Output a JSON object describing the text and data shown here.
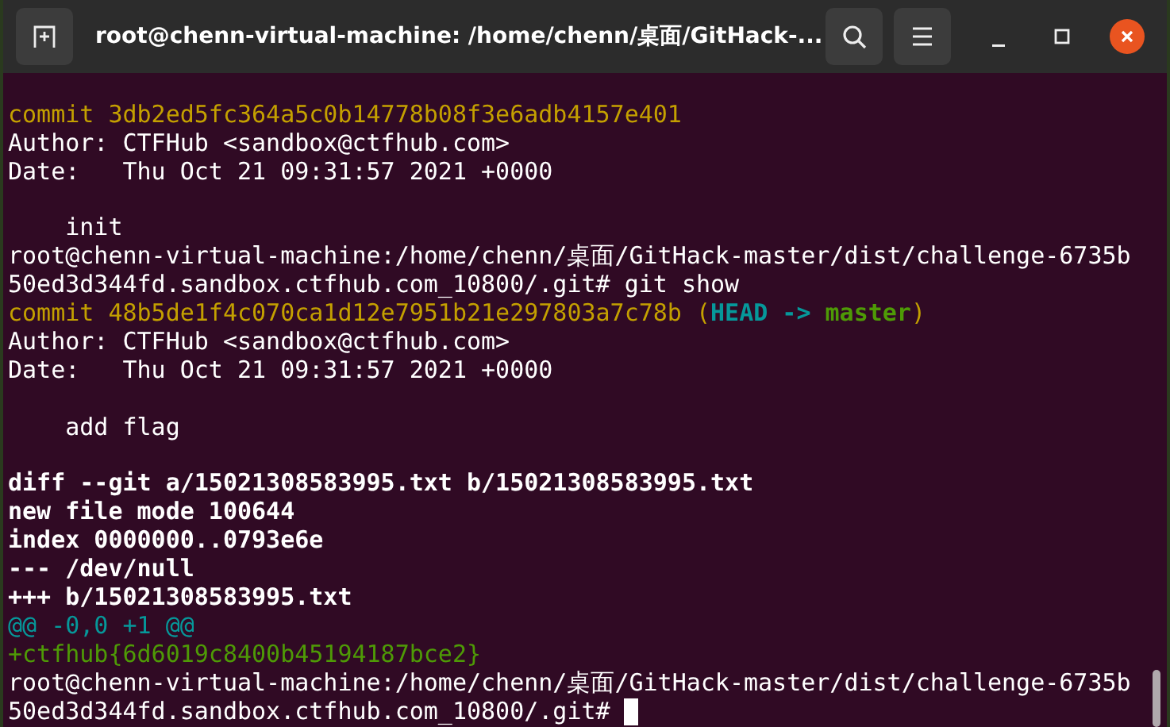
{
  "window": {
    "title": "root@chenn-virtual-machine: /home/chenn/桌面/GitHack-..."
  },
  "lines": [
    {
      "kind": "blank"
    },
    {
      "kind": "text",
      "segments": [
        {
          "text": "commit 3db2ed5fc364a5c0b14778b08f3e6adb4157e401",
          "kind": "commit"
        }
      ]
    },
    {
      "kind": "text",
      "segments": [
        {
          "text": "Author: CTFHub <sandbox@ctfhub.com>",
          "kind": "plain"
        }
      ]
    },
    {
      "kind": "text",
      "segments": [
        {
          "text": "Date:   Thu Oct 21 09:31:57 2021 +0000",
          "kind": "plain"
        }
      ]
    },
    {
      "kind": "blank"
    },
    {
      "kind": "text",
      "segments": [
        {
          "text": "    init",
          "kind": "plain"
        }
      ]
    },
    {
      "kind": "text",
      "segments": [
        {
          "text": "root@chenn-virtual-machine:/home/chenn/桌面/GitHack-master/dist/challenge-6735b",
          "kind": "plain"
        }
      ]
    },
    {
      "kind": "text",
      "segments": [
        {
          "text": "50ed3d344fd.sandbox.ctfhub.com_10800/.git# git show",
          "kind": "plain"
        }
      ]
    },
    {
      "kind": "text",
      "segments": [
        {
          "text": "commit 48b5de1f4c070ca1d12e7951b21e297803a7c78b (",
          "kind": "commit"
        },
        {
          "text": "HEAD -> ",
          "kind": "head"
        },
        {
          "text": "master",
          "kind": "branch"
        },
        {
          "text": ")",
          "kind": "commit"
        }
      ]
    },
    {
      "kind": "text",
      "segments": [
        {
          "text": "Author: CTFHub <sandbox@ctfhub.com>",
          "kind": "plain"
        }
      ]
    },
    {
      "kind": "text",
      "segments": [
        {
          "text": "Date:   Thu Oct 21 09:31:57 2021 +0000",
          "kind": "plain"
        }
      ]
    },
    {
      "kind": "blank"
    },
    {
      "kind": "text",
      "segments": [
        {
          "text": "    add flag",
          "kind": "plain"
        }
      ]
    },
    {
      "kind": "blank"
    },
    {
      "kind": "text",
      "segments": [
        {
          "text": "diff --git a/15021308583995.txt b/15021308583995.txt",
          "kind": "header"
        }
      ]
    },
    {
      "kind": "text",
      "segments": [
        {
          "text": "new file mode 100644",
          "kind": "header"
        }
      ]
    },
    {
      "kind": "text",
      "segments": [
        {
          "text": "index 0000000..0793e6e",
          "kind": "header"
        }
      ]
    },
    {
      "kind": "text",
      "segments": [
        {
          "text": "--- /dev/null",
          "kind": "header"
        }
      ]
    },
    {
      "kind": "text",
      "segments": [
        {
          "text": "+++ b/15021308583995.txt",
          "kind": "header"
        }
      ]
    },
    {
      "kind": "text",
      "segments": [
        {
          "text": "@@ -0,0 +1 @@",
          "kind": "hunk"
        }
      ]
    },
    {
      "kind": "text",
      "segments": [
        {
          "text": "+ctfhub{6d6019c8400b45194187bce2}",
          "kind": "added"
        }
      ]
    },
    {
      "kind": "text",
      "segments": [
        {
          "text": "root@chenn-virtual-machine:/home/chenn/桌面/GitHack-master/dist/challenge-6735b",
          "kind": "plain"
        }
      ]
    },
    {
      "kind": "text",
      "cursor": true,
      "segments": [
        {
          "text": "50ed3d344fd.sandbox.ctfhub.com_10800/.git# ",
          "kind": "plain"
        }
      ]
    }
  ]
}
